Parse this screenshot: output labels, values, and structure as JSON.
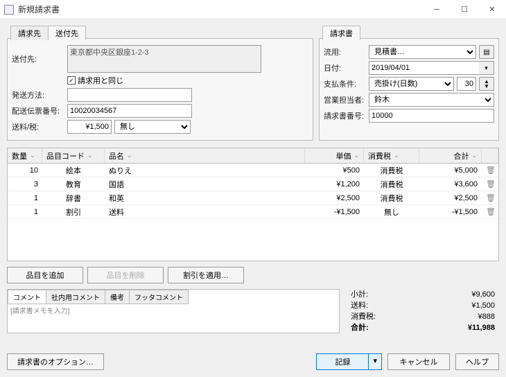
{
  "window": {
    "title": "新規請求書"
  },
  "tabs_left": {
    "invoice": "請求先",
    "ship": "送付先"
  },
  "tabs_right": {
    "invoice": "請求書"
  },
  "ship": {
    "label": "送付先:",
    "address": "東京都中央区銀座1-2-3",
    "same_checkbox": "請求用と同じ",
    "method_label": "発送方法:",
    "method_value": "",
    "tracking_label": "配送伝票番号:",
    "tracking_value": "10020034567",
    "postage_label": "送料/税:",
    "postage_value": "¥1,500",
    "postage_tax": "無し"
  },
  "invoice_meta": {
    "reuse_label": "流用:",
    "reuse_value": "見積書…",
    "date_label": "日付:",
    "date_value": "2019/04/01",
    "terms_label": "支払条件:",
    "terms_value": "売掛け(日数)",
    "terms_days": "30",
    "rep_label": "営業担当者:",
    "rep_value": "鈴木",
    "no_label": "請求書番号:",
    "no_value": "10000"
  },
  "columns": {
    "qty": "数量",
    "code": "品目コード",
    "name": "品名",
    "price": "単価",
    "tax": "消費税",
    "total": "合計"
  },
  "rows": [
    {
      "qty": "10",
      "code": "絵本",
      "name": "ぬりえ",
      "price": "¥500",
      "tax": "消費税",
      "total": "¥5,000"
    },
    {
      "qty": "3",
      "code": "教育",
      "name": "国語",
      "price": "¥1,200",
      "tax": "消費税",
      "total": "¥3,600"
    },
    {
      "qty": "1",
      "code": "辞書",
      "name": "和英",
      "price": "¥2,500",
      "tax": "消費税",
      "total": "¥2,500"
    },
    {
      "qty": "1",
      "code": "割引",
      "name": "送料",
      "price": "-¥1,500",
      "tax": "無し",
      "total": "-¥1,500"
    }
  ],
  "buttons": {
    "add_item": "品目を追加",
    "del_item": "品目を削除",
    "apply_discount": "割引を適用…",
    "options": "請求書のオプション…",
    "record": "記録",
    "cancel": "キャンセル",
    "help": "ヘルプ"
  },
  "comment_tabs": {
    "c1": "コメント",
    "c2": "社内用コメント",
    "c3": "備考",
    "c4": "フッタコメント"
  },
  "comment_placeholder": "[請求書メモを入力]",
  "totals": {
    "subtotal_label": "小計:",
    "subtotal": "¥9,600",
    "shipping_label": "送料:",
    "shipping": "¥1,500",
    "tax_label": "消費税:",
    "tax": "¥888",
    "total_label": "合計:",
    "total": "¥11,988"
  }
}
